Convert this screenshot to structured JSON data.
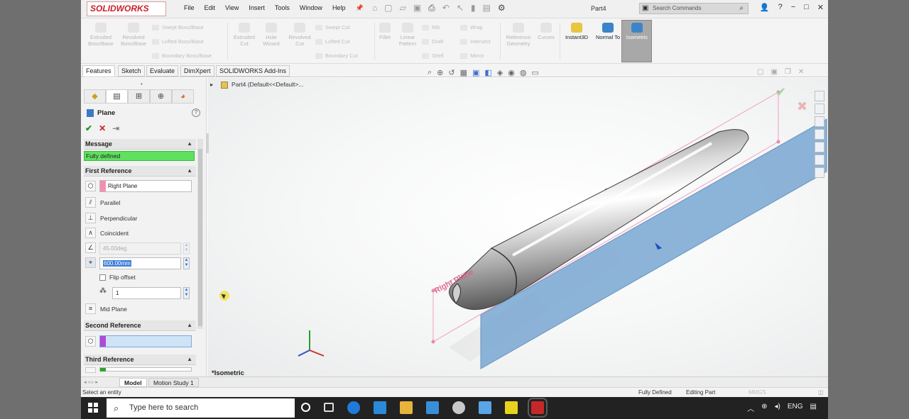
{
  "app": {
    "brand": "SOLIDWORKS",
    "menu": [
      "File",
      "Edit",
      "View",
      "Insert",
      "Tools",
      "Window",
      "Help"
    ],
    "document_name": "Part4",
    "search_placeholder": "Search Commands",
    "window_controls": [
      "−",
      "□",
      "✕"
    ]
  },
  "command_manager": {
    "features": [
      "Extruded Boss/Base",
      "Revolved Boss/Base",
      "Extruded Cut",
      "Hole Wizard",
      "Revolved Cut",
      "Fillet",
      "Linear Pattern",
      "Reference Geometry",
      "Curves",
      "Instant3D",
      "Normal To",
      "Isometric"
    ],
    "rows": [
      "Swept Boss/Base",
      "Lofted Boss/Base",
      "Boundary Boss/Base",
      "Swept Cut",
      "Lofted Cut",
      "Boundary Cut",
      "Rib",
      "Draft",
      "Shell",
      "Wrap",
      "Intersect",
      "Mirror"
    ]
  },
  "tabs": [
    "Features",
    "Sketch",
    "Evaluate",
    "DimXpert",
    "SOLIDWORKS Add-Ins"
  ],
  "property_manager": {
    "title": "Plane",
    "message_header": "Message",
    "message": "Fully defined",
    "first_reference": {
      "header": "First Reference",
      "entity": "Right Plane",
      "options": [
        "Parallel",
        "Perpendicular",
        "Coincident"
      ],
      "angle": "45.00deg",
      "distance": "600.00mm",
      "flip_offset": "Flip offset",
      "count": "1",
      "mid_plane": "Mid Plane"
    },
    "second_reference": {
      "header": "Second Reference"
    },
    "third_reference": {
      "header": "Third Reference"
    }
  },
  "viewport": {
    "tree_label": "Part4  (Default<<Default>...",
    "plane_label": "Right Plane",
    "view_label": "*Isometric"
  },
  "bottom_tabs": [
    "Model",
    "Motion Study 1"
  ],
  "status": {
    "left": "Select an entity",
    "state": "Fully Defined",
    "mode": "Editing Part",
    "units": "MMGS"
  },
  "taskbar": {
    "search_placeholder": "Type here to search",
    "language": "ENG"
  },
  "colors": {
    "accent_green": "#5fe05f",
    "plane_fill": "#7aa7d3",
    "reference_pink": "#f48fb1",
    "second_reference_purple": "#b04ad8"
  }
}
